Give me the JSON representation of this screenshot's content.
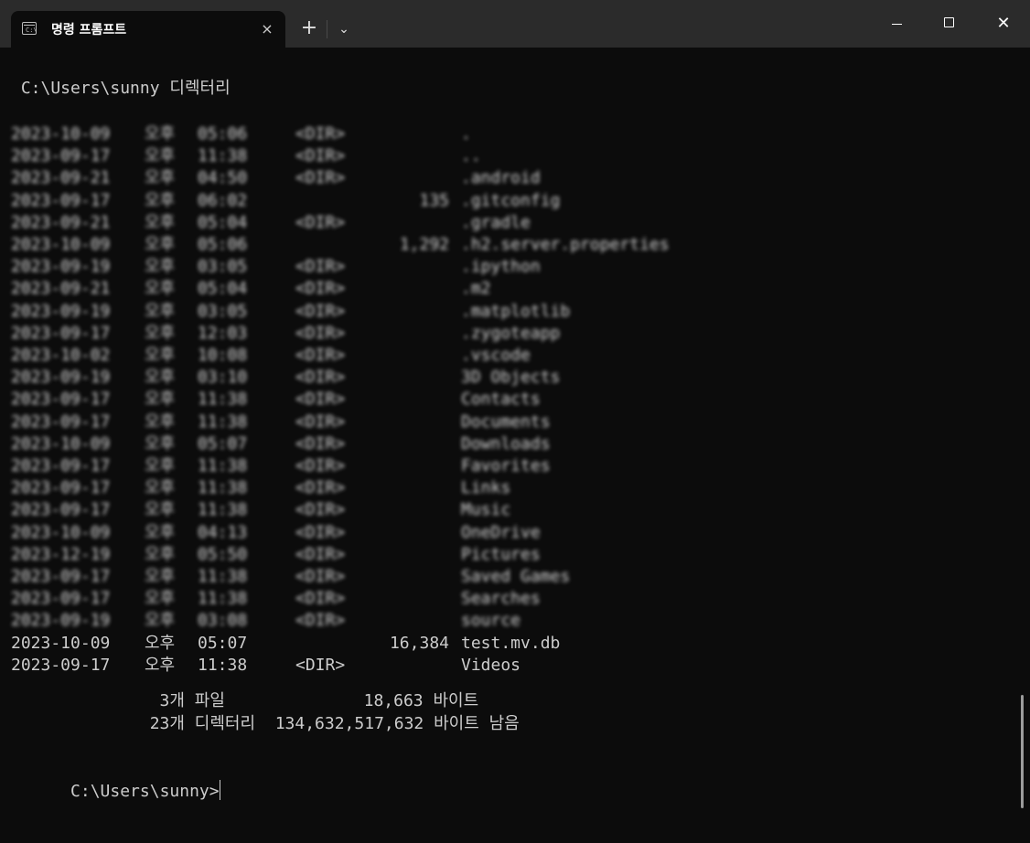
{
  "tab": {
    "title": "명령 프롬프트",
    "close_icon": "×"
  },
  "toolbar": {
    "new_tab": "+",
    "dropdown": "⌄"
  },
  "window_controls": {
    "close": "✕"
  },
  "console": {
    "header": " C:\\Users\\sunny 디렉터리",
    "entries": [
      [
        "2023-10-09",
        "오후",
        "05:06",
        "<DIR>",
        "",
        "."
      ],
      [
        "2023-09-17",
        "오후",
        "11:38",
        "<DIR>",
        "",
        ".."
      ],
      [
        "2023-09-21",
        "오후",
        "04:50",
        "<DIR>",
        "",
        ".android"
      ],
      [
        "2023-09-17",
        "오후",
        "06:02",
        "",
        "135",
        ".gitconfig"
      ],
      [
        "2023-09-21",
        "오후",
        "05:04",
        "<DIR>",
        "",
        ".gradle"
      ],
      [
        "2023-10-09",
        "오후",
        "05:06",
        "",
        "1,292",
        ".h2.server.properties"
      ],
      [
        "2023-09-19",
        "오후",
        "03:05",
        "<DIR>",
        "",
        ".ipython"
      ],
      [
        "2023-09-21",
        "오후",
        "05:04",
        "<DIR>",
        "",
        ".m2"
      ],
      [
        "2023-09-19",
        "오후",
        "03:05",
        "<DIR>",
        "",
        ".matplotlib"
      ],
      [
        "2023-09-17",
        "오후",
        "12:03",
        "<DIR>",
        "",
        ".zygoteapp"
      ],
      [
        "2023-10-02",
        "오후",
        "10:08",
        "<DIR>",
        "",
        ".vscode"
      ],
      [
        "2023-09-19",
        "오후",
        "03:10",
        "<DIR>",
        "",
        "3D Objects"
      ],
      [
        "2023-09-17",
        "오후",
        "11:38",
        "<DIR>",
        "",
        "Contacts"
      ],
      [
        "2023-09-17",
        "오후",
        "11:38",
        "<DIR>",
        "",
        "Documents"
      ],
      [
        "2023-10-09",
        "오후",
        "05:07",
        "<DIR>",
        "",
        "Downloads"
      ],
      [
        "2023-09-17",
        "오후",
        "11:38",
        "<DIR>",
        "",
        "Favorites"
      ],
      [
        "2023-09-17",
        "오후",
        "11:38",
        "<DIR>",
        "",
        "Links"
      ],
      [
        "2023-09-17",
        "오후",
        "11:38",
        "<DIR>",
        "",
        "Music"
      ],
      [
        "2023-10-09",
        "오후",
        "04:13",
        "<DIR>",
        "",
        "OneDrive"
      ],
      [
        "2023-12-19",
        "오후",
        "05:50",
        "<DIR>",
        "",
        "Pictures"
      ],
      [
        "2023-09-17",
        "오후",
        "11:38",
        "<DIR>",
        "",
        "Saved Games"
      ],
      [
        "2023-09-17",
        "오후",
        "11:38",
        "<DIR>",
        "",
        "Searches"
      ],
      [
        "2023-09-19",
        "오후",
        "03:08",
        "<DIR>",
        "",
        "source"
      ],
      [
        "2023-10-09",
        "오후",
        "05:07",
        "",
        "16,384",
        "test.mv.db"
      ],
      [
        "2023-09-17",
        "오후",
        "11:38",
        "<DIR>",
        "",
        "Videos"
      ]
    ],
    "summary_files": "               3개 파일              18,663 바이트",
    "summary_dirs": "              23개 디렉터리  134,632,517,632 바이트 남음",
    "prompt": "C:\\Users\\sunny>"
  }
}
